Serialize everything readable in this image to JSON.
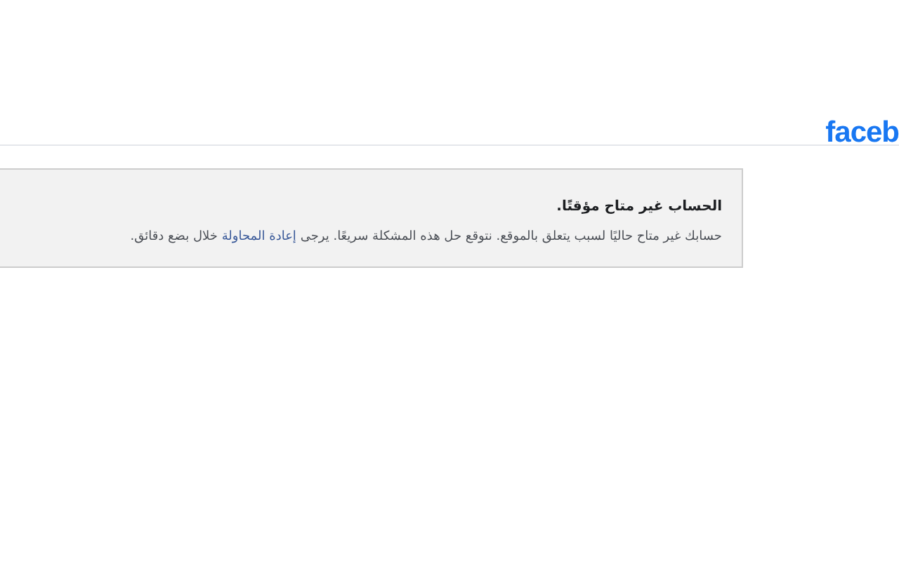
{
  "header": {
    "logo": "faceb"
  },
  "notice": {
    "title": "الحساب غير متاح مؤقتًا.",
    "message_before": "حسابك غير متاح حاليًا لسبب يتعلق بالموقع. نتوقع حل هذه المشكلة سريعًا. يرجى",
    "link": "إعادة المحاولة",
    "message_after": "خلال بضع دقائق."
  }
}
